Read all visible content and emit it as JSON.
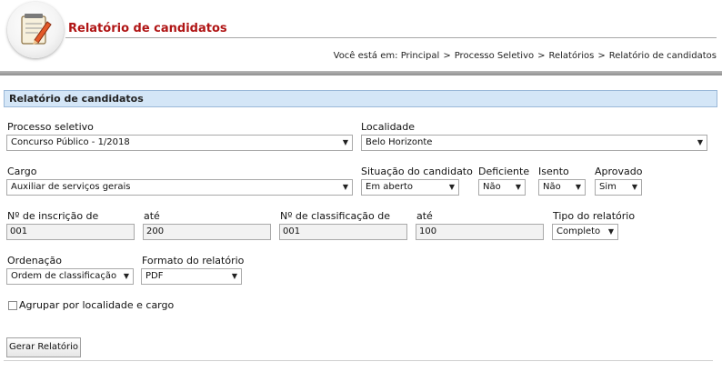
{
  "header": {
    "title": "Relatório de candidatos",
    "breadcrumb_prefix": "Você está em:",
    "breadcrumb": [
      "Principal",
      "Processo Seletivo",
      "Relatórios",
      "Relatório de candidatos"
    ],
    "breadcrumb_sep": ">"
  },
  "section": {
    "title": "Relatório de candidatos"
  },
  "form": {
    "processo": {
      "label": "Processo seletivo",
      "value": "Concurso Público - 1/2018"
    },
    "localidade": {
      "label": "Localidade",
      "value": "Belo Horizonte"
    },
    "cargo": {
      "label": "Cargo",
      "value": "Auxiliar de serviços gerais"
    },
    "situacao": {
      "label": "Situação do candidato",
      "value": "Em aberto"
    },
    "deficiente": {
      "label": "Deficiente",
      "value": "Não"
    },
    "isento": {
      "label": "Isento",
      "value": "Não"
    },
    "aprovado": {
      "label": "Aprovado",
      "value": "Sim"
    },
    "inscricao_de": {
      "label": "Nº de inscrição de",
      "value": "001"
    },
    "inscricao_ate": {
      "label": "até",
      "value": "200"
    },
    "classificacao_de": {
      "label": "Nº de classificação de",
      "value": "001"
    },
    "classificacao_ate": {
      "label": "até",
      "value": "100"
    },
    "tipo": {
      "label": "Tipo do relatório",
      "value": "Completo"
    },
    "ordenacao": {
      "label": "Ordenação",
      "value": "Ordem de classificação"
    },
    "formato": {
      "label": "Formato do relatório",
      "value": "PDF"
    },
    "agrupar": {
      "label": "Agrupar por localidade e cargo",
      "checked": false
    },
    "submit_label": "Gerar Relatório"
  },
  "icons": {
    "logo": "notepad-pencil-icon",
    "dropdown": "chevron-down-icon"
  },
  "colors": {
    "title": "#b01515",
    "section_bar": "#d4e6f7"
  }
}
